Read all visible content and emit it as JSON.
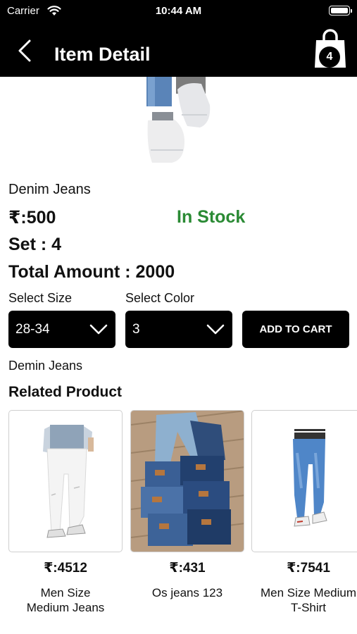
{
  "status_bar": {
    "carrier": "Carrier",
    "time": "10:44 AM"
  },
  "nav": {
    "title": "Item Detail",
    "cart_count": "4",
    "back_icon": "chevron-left-icon",
    "cart_icon": "shopping-bag-icon"
  },
  "product": {
    "name": "Denim Jeans",
    "price": "₹:500",
    "stock_status": "In Stock",
    "stock_color": "#2a8a34",
    "set": "Set : 4",
    "total": "Total Amount : 2000",
    "description": "Demin Jeans"
  },
  "options": {
    "size_label": "Select Size",
    "size_value": "28-34",
    "color_label": "Select Color",
    "color_value": "3",
    "add_to_cart": "ADD TO CART"
  },
  "related": {
    "heading": "Related Product",
    "items": [
      {
        "price": "₹:4512",
        "name_line1": "Men Size",
        "name_line2": "Medium Jeans"
      },
      {
        "price": "₹:431",
        "name_line1": "Os jeans 123",
        "name_line2": ""
      },
      {
        "price": "₹:7541",
        "name_line1": "Men Size Medium",
        "name_line2": "T-Shirt"
      }
    ]
  }
}
